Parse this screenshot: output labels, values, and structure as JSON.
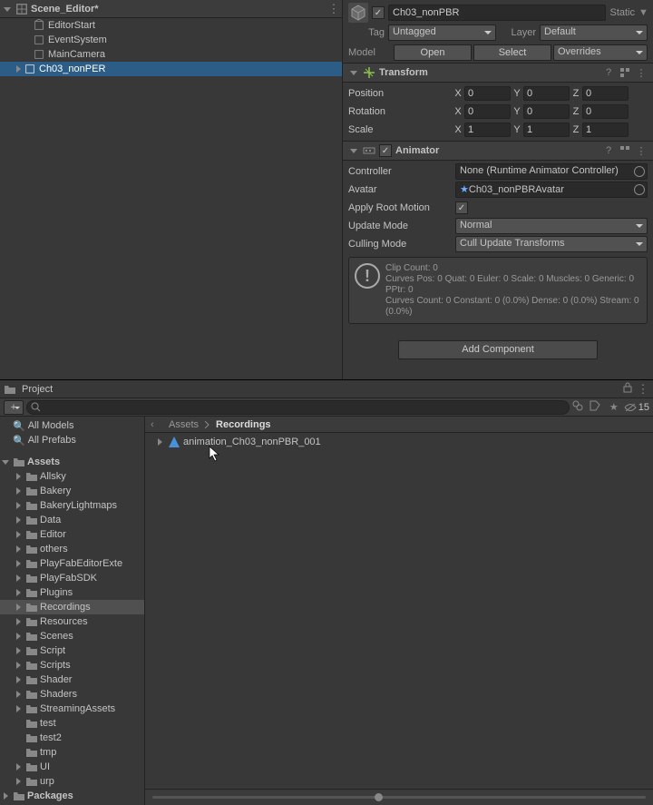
{
  "hierarchy": {
    "scene_name": "Scene_Editor*",
    "items": [
      {
        "name": "EditorStart"
      },
      {
        "name": "EventSystem"
      },
      {
        "name": "MainCamera"
      },
      {
        "name": "Ch03_nonPER",
        "selected": true,
        "foldable": true
      }
    ]
  },
  "inspector": {
    "name_field": "Ch03_nonPBR",
    "static_label": "Static",
    "tag_label": "Tag",
    "tag_value": "Untagged",
    "layer_label": "Layer",
    "layer_value": "Default",
    "model_label": "Model",
    "open_btn": "Open",
    "select_btn": "Select",
    "overrides_btn": "Overrides",
    "transform": {
      "title": "Transform",
      "position_label": "Position",
      "rotation_label": "Rotation",
      "scale_label": "Scale",
      "px": "0",
      "py": "0",
      "pz": "0",
      "rx": "0",
      "ry": "0",
      "rz": "0",
      "sx": "1",
      "sy": "1",
      "sz": "1"
    },
    "animator": {
      "title": "Animator",
      "controller_label": "Controller",
      "controller_value": "None (Runtime Animator Controller)",
      "avatar_label": "Avatar",
      "avatar_value": "Ch03_nonPBRAvatar",
      "arm_label": "Apply Root Motion",
      "update_label": "Update Mode",
      "update_value": "Normal",
      "culling_label": "Culling Mode",
      "culling_value": "Cull Update Transforms",
      "clip_info": "Clip Count: 0\nCurves Pos: 0 Quat: 0 Euler: 0 Scale: 0 Muscles: 0 Generic: 0 PPtr: 0\nCurves Count: 0 Constant: 0 (0.0%) Dense: 0 (0.0%) Stream: 0 (0.0%)"
    },
    "add_component": "Add Component"
  },
  "project": {
    "tab_label": "Project",
    "visible_count": "15",
    "favorites": [
      {
        "label": "All Models"
      },
      {
        "label": "All Prefabs"
      }
    ],
    "assets_label": "Assets",
    "folders": [
      "Allsky",
      "Bakery",
      "BakeryLightmaps",
      "Data",
      "Editor",
      "others",
      "PlayFabEditorExtensions",
      "PlayFabSDK",
      "Plugins",
      "Recordings",
      "Resources",
      "Scenes",
      "Script",
      "Scripts",
      "Shader",
      "Shaders",
      "StreamingAssets",
      "test",
      "test2",
      "tmp",
      "UI",
      "urp"
    ],
    "packages_label": "Packages",
    "breadcrumb": {
      "root": "Assets",
      "current": "Recordings"
    },
    "files": [
      {
        "name": "animation_Ch03_nonPBR_001"
      }
    ],
    "selected_folder": "Recordings"
  }
}
